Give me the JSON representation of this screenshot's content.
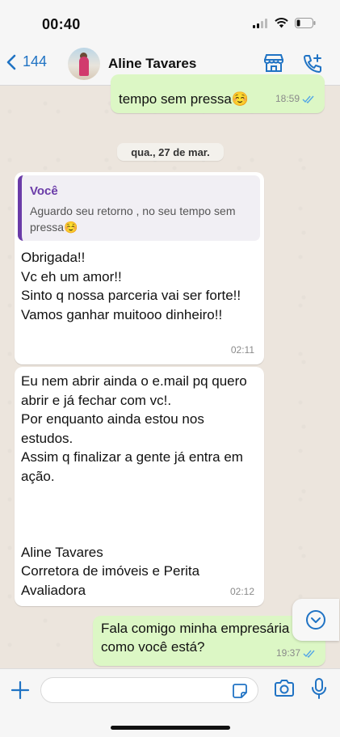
{
  "status_bar": {
    "time": "00:40"
  },
  "header": {
    "back_count": "144",
    "contact_name": "Aline Tavares"
  },
  "messages": {
    "top_out": {
      "text": "tempo sem pressa☺️",
      "time": "18:59"
    },
    "date_separator": "qua., 27 de mar.",
    "reply": {
      "quote_author": "Você",
      "quote_text": "Aguardo seu retorno , no seu tempo sem pressa☺️",
      "text": "Obrigada!!\nVc eh um amor!!\nSinto q nossa parceria vai ser forte!!\nVamos ganhar muitooo dinheiro!!",
      "time": "02:11"
    },
    "second_in": {
      "text": "Eu nem abrir ainda o e.mail pq quero abrir e já fechar com vc!.\nPor enquanto ainda estou nos estudos.\nAssim q finalizar a gente já entra em ação.\n\n\n\nAline Tavares\nCorretora de imóveis e Perita Avaliadora",
      "time": "02:12"
    },
    "last_out": {
      "text": "Fala comigo minha empresária\ncomo você está?",
      "time": "19:37"
    }
  },
  "icons": {
    "back": "chevron-left-icon",
    "store": "store-icon",
    "call": "call-add-icon",
    "scroll": "chevron-down-circle-icon",
    "plus": "plus-icon",
    "sticker": "sticker-icon",
    "camera": "camera-icon",
    "mic": "microphone-icon",
    "read": "double-check-icon"
  },
  "colors": {
    "accent": "#2073c4",
    "outgoing_bubble": "#dcf7c5",
    "incoming_bubble": "#ffffff",
    "quote_bar": "#6a3ba8",
    "read_ticks": "#53a6e6"
  }
}
